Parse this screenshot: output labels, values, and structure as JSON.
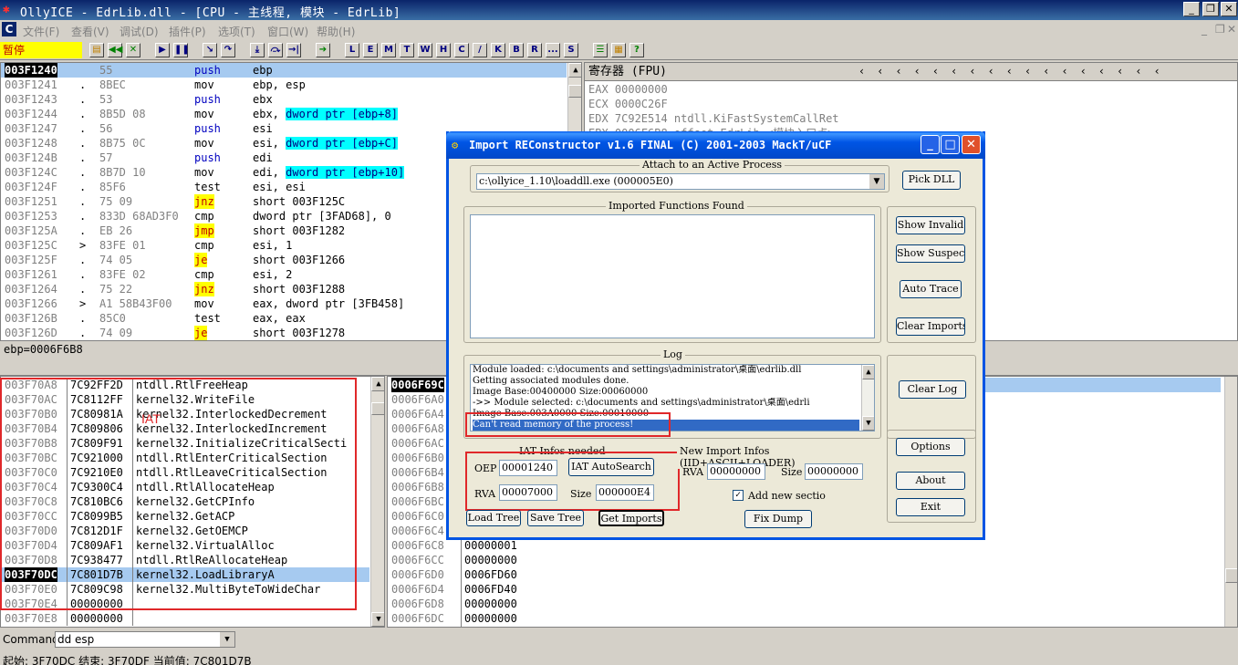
{
  "app": {
    "title": "OllyICE - EdrLib.dll - [CPU - 主线程, 模块 - EdrLib]",
    "status_mode": "暂停",
    "menu": [
      "文件(F)",
      "查看(V)",
      "调试(D)",
      "插件(P)",
      "选项(T)",
      "窗口(W)",
      "帮助(H)"
    ],
    "toolbar_letters": [
      "L",
      "E",
      "M",
      "T",
      "W",
      "H",
      "C",
      "/",
      "K",
      "B",
      "R",
      "...",
      "S"
    ]
  },
  "disasm": {
    "rows": [
      {
        "addr": "003F1240",
        "mark": "",
        "hex": "55",
        "mn": "push",
        "op": "ebp",
        "sel": true
      },
      {
        "addr": "003F1241",
        "mark": ".",
        "hex": "8BEC",
        "mn": "mov",
        "op": "ebp, esp"
      },
      {
        "addr": "003F1243",
        "mark": ".",
        "hex": "53",
        "mn": "push",
        "op": "ebx"
      },
      {
        "addr": "003F1244",
        "mark": ".",
        "hex": "8B5D 08",
        "mn": "mov",
        "op": "ebx, dword ptr [ebp+8]",
        "hl": "dword ptr [ebp+8]"
      },
      {
        "addr": "003F1247",
        "mark": ".",
        "hex": "56",
        "mn": "push",
        "op": "esi"
      },
      {
        "addr": "003F1248",
        "mark": ".",
        "hex": "8B75 0C",
        "mn": "mov",
        "op": "esi, dword ptr [ebp+C]",
        "hl": "dword ptr [ebp+C]"
      },
      {
        "addr": "003F124B",
        "mark": ".",
        "hex": "57",
        "mn": "push",
        "op": "edi"
      },
      {
        "addr": "003F124C",
        "mark": ".",
        "hex": "8B7D 10",
        "mn": "mov",
        "op": "edi, dword ptr [ebp+10]",
        "hl": "dword ptr [ebp+10]"
      },
      {
        "addr": "003F124F",
        "mark": ".",
        "hex": "85F6",
        "mn": "test",
        "op": "esi, esi"
      },
      {
        "addr": "003F1251",
        "mark": ".",
        "hex": "75 09",
        "mn": "jnz",
        "op": "short 003F125C",
        "jmp": true
      },
      {
        "addr": "003F1253",
        "mark": ".",
        "hex": "833D 68AD3F0",
        "mn": "cmp",
        "op": "dword ptr [3FAD68], 0"
      },
      {
        "addr": "003F125A",
        "mark": ".",
        "hex": "EB 26",
        "mn": "jmp",
        "op": "short 003F1282",
        "jmp": true
      },
      {
        "addr": "003F125C",
        "mark": ">",
        "hex": "83FE 01",
        "mn": "cmp",
        "op": "esi, 1"
      },
      {
        "addr": "003F125F",
        "mark": ".",
        "hex": "74 05",
        "mn": "je",
        "op": "short 003F1266",
        "jmp": true
      },
      {
        "addr": "003F1261",
        "mark": ".",
        "hex": "83FE 02",
        "mn": "cmp",
        "op": "esi, 2"
      },
      {
        "addr": "003F1264",
        "mark": ".",
        "hex": "75 22",
        "mn": "jnz",
        "op": "short 003F1288",
        "jmp": true
      },
      {
        "addr": "003F1266",
        "mark": ">",
        "hex": "A1 58B43F00",
        "mn": "mov",
        "op": "eax, dword ptr [3FB458]"
      },
      {
        "addr": "003F126B",
        "mark": ".",
        "hex": "85C0",
        "mn": "test",
        "op": "eax, eax"
      },
      {
        "addr": "003F126D",
        "mark": ".",
        "hex": "74 09",
        "mn": "je",
        "op": "short 003F1278",
        "jmp": true
      }
    ],
    "info_line": "ebp=0006F6B8"
  },
  "registers": {
    "header": "寄存器 (FPU)",
    "rows": [
      "EAX 00000000",
      "ECX 0000C26F",
      "EDX 7C92E514 ntdll.KiFastSystemCallRet",
      "EBX 0006F6B8 offset EdrLib.<模块入口点>"
    ]
  },
  "dump": {
    "rows": [
      {
        "addr": "003F70A8",
        "val": "7C92FF2D",
        "c": "ntdll.RtlFreeHeap"
      },
      {
        "addr": "003F70AC",
        "val": "7C8112FF",
        "c": "kernel32.WriteFile"
      },
      {
        "addr": "003F70B0",
        "val": "7C80981A",
        "c": "kernel32.InterlockedDecrement"
      },
      {
        "addr": "003F70B4",
        "val": "7C809806",
        "c": "kernel32.InterlockedIncrement"
      },
      {
        "addr": "003F70B8",
        "val": "7C809F91",
        "c": "kernel32.InitializeCriticalSecti"
      },
      {
        "addr": "003F70BC",
        "val": "7C921000",
        "c": "ntdll.RtlEnterCriticalSection"
      },
      {
        "addr": "003F70C0",
        "val": "7C9210E0",
        "c": "ntdll.RtlLeaveCriticalSection"
      },
      {
        "addr": "003F70C4",
        "val": "7C9300C4",
        "c": "ntdll.RtlAllocateHeap"
      },
      {
        "addr": "003F70C8",
        "val": "7C810BC6",
        "c": "kernel32.GetCPInfo"
      },
      {
        "addr": "003F70CC",
        "val": "7C8099B5",
        "c": "kernel32.GetACP"
      },
      {
        "addr": "003F70D0",
        "val": "7C812D1F",
        "c": "kernel32.GetOEMCP"
      },
      {
        "addr": "003F70D4",
        "val": "7C809AF1",
        "c": "kernel32.VirtualAlloc"
      },
      {
        "addr": "003F70D8",
        "val": "7C938477",
        "c": "ntdll.RtlReAllocateHeap"
      },
      {
        "addr": "003F70DC",
        "val": "7C801D7B",
        "c": "kernel32.LoadLibraryA",
        "sel": true
      },
      {
        "addr": "003F70E0",
        "val": "7C809C98",
        "c": "kernel32.MultiByteToWideChar"
      },
      {
        "addr": "003F70E4",
        "val": "00000000",
        "c": ""
      },
      {
        "addr": "003F70E8",
        "val": "00000000",
        "c": ""
      }
    ],
    "annotation": "IAT"
  },
  "stack": {
    "rows": [
      {
        "addr": "0006F69C",
        "val": ""
      },
      {
        "addr": "0006F6A0",
        "val": ""
      },
      {
        "addr": "0006F6A4",
        "val": ""
      },
      {
        "addr": "0006F6A8",
        "val": ""
      },
      {
        "addr": "0006F6AC",
        "val": ""
      },
      {
        "addr": "0006F6B0",
        "val": ""
      },
      {
        "addr": "0006F6B4",
        "val": ""
      },
      {
        "addr": "0006F6B8",
        "val": ""
      },
      {
        "addr": "0006F6BC",
        "val": ""
      },
      {
        "addr": "0006F6C0",
        "val": ""
      },
      {
        "addr": "0006F6C4",
        "val": ""
      },
      {
        "addr": "0006F6C8",
        "val": "00000001"
      },
      {
        "addr": "0006F6CC",
        "val": "00000000"
      },
      {
        "addr": "0006F6D0",
        "val": "0006FD60"
      },
      {
        "addr": "0006F6D4",
        "val": "0006FD40"
      },
      {
        "addr": "0006F6D8",
        "val": "00000000"
      },
      {
        "addr": "0006F6DC",
        "val": "00000000"
      }
    ]
  },
  "command": {
    "label": "Command",
    "value": "dd esp"
  },
  "statusbar": "起始: 3F70DC 结束: 3F70DF 当前值: 7C801D7B",
  "importrec": {
    "title": "Import REConstructor v1.6 FINAL (C) 2001-2003 MackT/uCF",
    "attach_caption": "Attach to an Active Process",
    "process_value": "c:\\ollyice_1.10\\loaddll.exe (000005E0)",
    "pick_dll": "Pick DLL",
    "imported_caption": "Imported Functions Found",
    "show_invalid": "Show Invalid",
    "show_suspect": "Show Suspect",
    "auto_trace": "Auto Trace",
    "clear_imports": "Clear Imports",
    "log_caption": "Log",
    "log_lines": [
      "Module loaded: c:\\documents and settings\\administrator\\桌面\\edrlib.dll",
      "Getting associated modules done.",
      "Image Base:00400000 Size:00060000",
      "->> Module selected: c:\\documents and settings\\administrator\\桌面\\edrli",
      "Image Base:003A0000 Size:00010000",
      "Can't read memory of the process!"
    ],
    "clear_log": "Clear Log",
    "iat_caption": "IAT Infos needed",
    "oep_label": "OEP",
    "oep_value": "00001240",
    "iat_autosearch": "IAT AutoSearch",
    "rva_label": "RVA",
    "rva_value": "00007000",
    "size_label": "Size",
    "size_value": "000000E4",
    "new_import_caption": "New Import Infos (IID+ASCII+LOADER)",
    "new_rva_label": "RVA",
    "new_rva_value": "00000000",
    "new_size_label": "Size",
    "new_size_value": "00000000",
    "add_new_section": "Add new sectio",
    "options": "Options",
    "about": "About",
    "exit": "Exit",
    "load_tree": "Load Tree",
    "save_tree": "Save Tree",
    "get_imports": "Get Imports",
    "fix_dump": "Fix Dump"
  },
  "colors": {
    "accent_red": "#e0282a",
    "highlight_cyan": "#00ffff",
    "jump_yellow": "#ffff00",
    "selection": "#a6caf0"
  }
}
